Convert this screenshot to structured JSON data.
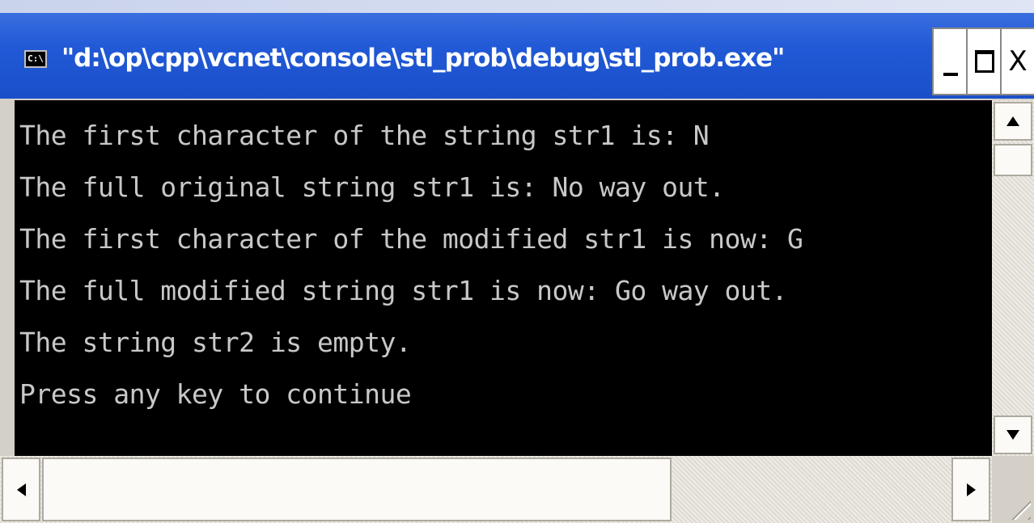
{
  "window": {
    "title": "\"d:\\op\\cpp\\vcnet\\console\\stl_prob\\debug\\stl_prob.exe\"",
    "icon_text": "C:\\",
    "icon": "console-app-icon",
    "buttons": {
      "minimize": "minimize-icon",
      "maximize": "maximize-icon",
      "close_label": "X"
    }
  },
  "console": {
    "lines": [
      "The first character of the string str1 is: N",
      "The full original string str1 is: No way out.",
      "The first character of the modified str1 is now: G",
      "The full modified string str1 is now: Go way out.",
      "The string str2 is empty.",
      "Press any key to continue"
    ]
  },
  "colors": {
    "titlebar": "#2159d6",
    "console_bg": "#000000",
    "console_text": "#c8c8c8"
  }
}
